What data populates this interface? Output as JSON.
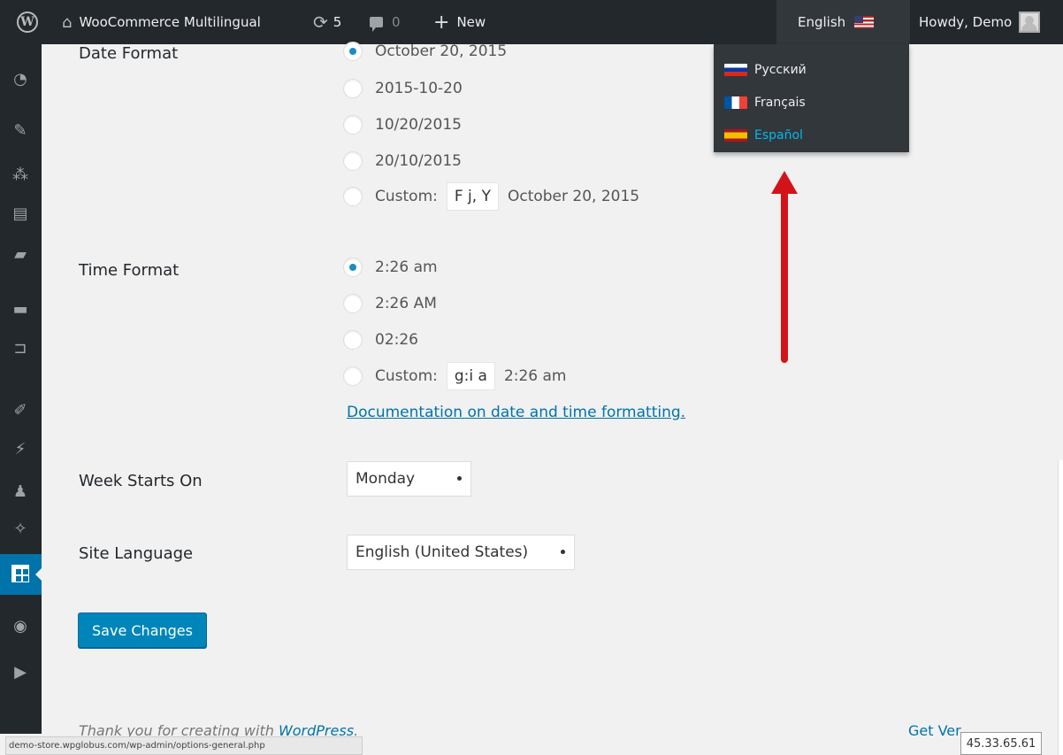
{
  "adminbar": {
    "site_name": "WooCommerce Multilingual",
    "updates_count": "5",
    "comments_count": "0",
    "new_label": "New",
    "language_label": "English",
    "howdy": "Howdy, Demo"
  },
  "language_menu": [
    {
      "label": "Русский",
      "flag": "ru"
    },
    {
      "label": "Français",
      "flag": "fr"
    },
    {
      "label": "Español",
      "flag": "es",
      "active": true
    }
  ],
  "sidebar_icons": [
    "dashboard-icon",
    "pin-icon",
    "translate-icon",
    "pages-icon",
    "comments-icon",
    "woo-icon",
    "cart-icon",
    "appearance-icon",
    "plugins-icon",
    "users-icon",
    "tools-icon",
    "settings-icon",
    "globe-icon",
    "play-icon"
  ],
  "settings": {
    "date_format_label": "Date Format",
    "date_options": [
      "October 20, 2015",
      "2015-10-20",
      "10/20/2015",
      "20/10/2015"
    ],
    "date_custom_label": "Custom:",
    "date_custom_value": "F j, Y",
    "date_custom_preview": "October 20, 2015",
    "time_format_label": "Time Format",
    "time_options": [
      "2:26 am",
      "2:26 AM",
      "02:26"
    ],
    "time_custom_label": "Custom:",
    "time_custom_value": "g:i a",
    "time_custom_preview": "2:26 am",
    "doc_link": "Documentation on date and time formatting",
    "doc_link_suffix": ".",
    "week_label": "Week Starts On",
    "week_value": "Monday",
    "language_label": "Site Language",
    "language_value": "English (United States)",
    "save_label": "Save Changes"
  },
  "footer": {
    "thanks_prefix": "Thank you for creating with ",
    "thanks_link": "WordPress",
    "thanks_suffix": ".",
    "version": "Get Ver",
    "status_url": "demo-store.wpglobus.com/wp-admin/options-general.php",
    "ip": "45.33.65.61"
  },
  "colors": {
    "accent": "#0073aa",
    "adminbar": "#23282d",
    "arrow": "#d2141a",
    "active_lang": "#00b9eb"
  }
}
